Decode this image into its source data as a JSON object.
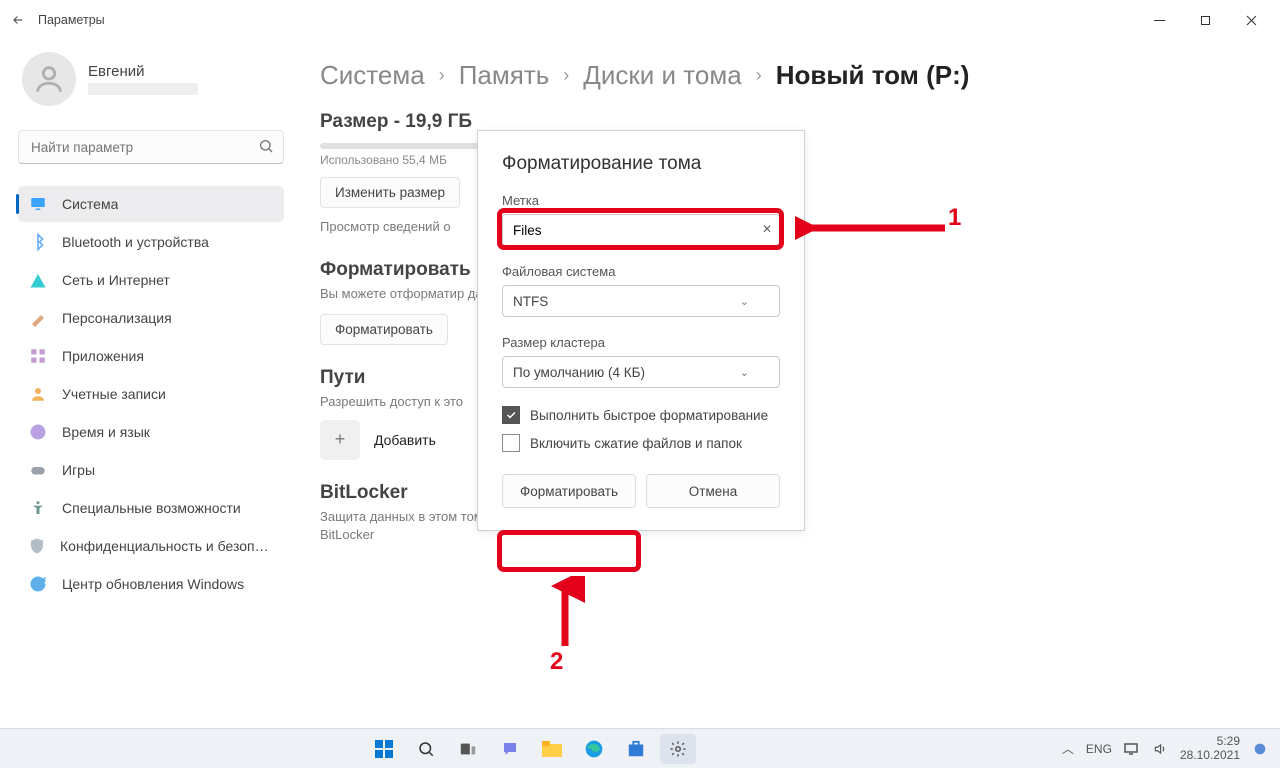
{
  "titlebar": {
    "title": "Параметры"
  },
  "user": {
    "name": "Евгений"
  },
  "search": {
    "placeholder": "Найти параметр"
  },
  "nav": [
    {
      "label": "Система",
      "icon": "monitor",
      "color": "#3aa3ff",
      "sel": true
    },
    {
      "label": "Bluetooth и устройства",
      "icon": "bt",
      "color": "#5aa6ff"
    },
    {
      "label": "Сеть и Интернет",
      "icon": "wifi",
      "color": "#34cdd4"
    },
    {
      "label": "Персонализация",
      "icon": "brush",
      "color": "#e0a87e"
    },
    {
      "label": "Приложения",
      "icon": "apps",
      "color": "#c29dd1"
    },
    {
      "label": "Учетные записи",
      "icon": "person",
      "color": "#f3b45b"
    },
    {
      "label": "Время и язык",
      "icon": "clock",
      "color": "#b8a2e2"
    },
    {
      "label": "Игры",
      "icon": "game",
      "color": "#9aa1aa"
    },
    {
      "label": "Специальные возможности",
      "icon": "acc",
      "color": "#6d968e"
    },
    {
      "label": "Конфиденциальность и безопасность",
      "icon": "shield",
      "color": "#b2bdc6"
    },
    {
      "label": "Центр обновления Windows",
      "icon": "upd",
      "color": "#5fb0ea"
    }
  ],
  "breadcrumb": {
    "items": [
      "Система",
      "Память",
      "Диски и тома"
    ],
    "current": "Новый том (P:)"
  },
  "size": {
    "title": "Размер - 19,9 ГБ",
    "used": "Использовано 55,4 МБ",
    "resize": "Изменить размер",
    "view": "Просмотр сведений о"
  },
  "format_sect": {
    "title": "Форматировать",
    "note": "Вы можете отформатир\nданные на нем.",
    "btn": "Форматировать"
  },
  "paths": {
    "title": "Пути",
    "note": "Разрешить доступ к это",
    "add": "Добавить"
  },
  "bitlocker": {
    "title": "BitLocker",
    "note": "Защита данных в этом томе путем его шифрования с помощью BitLocker"
  },
  "dialog": {
    "title": "Форматирование тома",
    "label_field": "Метка",
    "label_value": "Files",
    "fs_field": "Файловая система",
    "fs_value": "NTFS",
    "cluster_field": "Размер кластера",
    "cluster_value": "По умолчанию (4 КБ)",
    "quick": "Выполнить быстрое форматирование",
    "compress": "Включить сжатие файлов и папок",
    "ok": "Форматировать",
    "cancel": "Отмена"
  },
  "annotations": {
    "n1": "1",
    "n2": "2"
  },
  "tray": {
    "lang": "ENG",
    "time": "5:29",
    "date": "28.10.2021"
  }
}
